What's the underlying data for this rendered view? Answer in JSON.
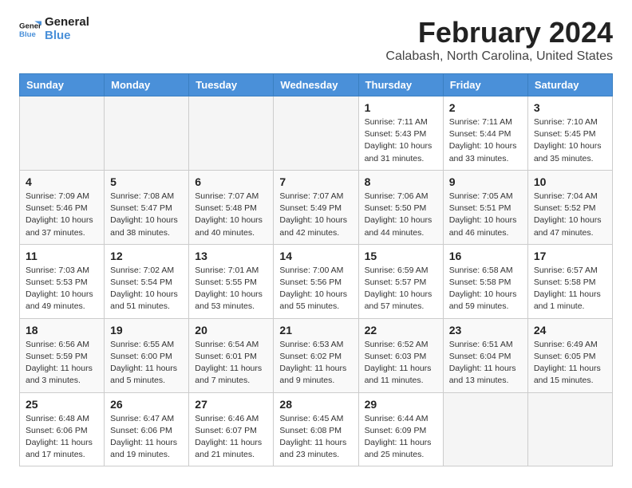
{
  "logo": {
    "line1": "General",
    "line2": "Blue"
  },
  "title": "February 2024",
  "location": "Calabash, North Carolina, United States",
  "weekdays": [
    "Sunday",
    "Monday",
    "Tuesday",
    "Wednesday",
    "Thursday",
    "Friday",
    "Saturday"
  ],
  "weeks": [
    [
      {
        "day": "",
        "info": "",
        "empty": true
      },
      {
        "day": "",
        "info": "",
        "empty": true
      },
      {
        "day": "",
        "info": "",
        "empty": true
      },
      {
        "day": "",
        "info": "",
        "empty": true
      },
      {
        "day": "1",
        "info": "Sunrise: 7:11 AM\nSunset: 5:43 PM\nDaylight: 10 hours\nand 31 minutes."
      },
      {
        "day": "2",
        "info": "Sunrise: 7:11 AM\nSunset: 5:44 PM\nDaylight: 10 hours\nand 33 minutes."
      },
      {
        "day": "3",
        "info": "Sunrise: 7:10 AM\nSunset: 5:45 PM\nDaylight: 10 hours\nand 35 minutes."
      }
    ],
    [
      {
        "day": "4",
        "info": "Sunrise: 7:09 AM\nSunset: 5:46 PM\nDaylight: 10 hours\nand 37 minutes."
      },
      {
        "day": "5",
        "info": "Sunrise: 7:08 AM\nSunset: 5:47 PM\nDaylight: 10 hours\nand 38 minutes."
      },
      {
        "day": "6",
        "info": "Sunrise: 7:07 AM\nSunset: 5:48 PM\nDaylight: 10 hours\nand 40 minutes."
      },
      {
        "day": "7",
        "info": "Sunrise: 7:07 AM\nSunset: 5:49 PM\nDaylight: 10 hours\nand 42 minutes."
      },
      {
        "day": "8",
        "info": "Sunrise: 7:06 AM\nSunset: 5:50 PM\nDaylight: 10 hours\nand 44 minutes."
      },
      {
        "day": "9",
        "info": "Sunrise: 7:05 AM\nSunset: 5:51 PM\nDaylight: 10 hours\nand 46 minutes."
      },
      {
        "day": "10",
        "info": "Sunrise: 7:04 AM\nSunset: 5:52 PM\nDaylight: 10 hours\nand 47 minutes."
      }
    ],
    [
      {
        "day": "11",
        "info": "Sunrise: 7:03 AM\nSunset: 5:53 PM\nDaylight: 10 hours\nand 49 minutes."
      },
      {
        "day": "12",
        "info": "Sunrise: 7:02 AM\nSunset: 5:54 PM\nDaylight: 10 hours\nand 51 minutes."
      },
      {
        "day": "13",
        "info": "Sunrise: 7:01 AM\nSunset: 5:55 PM\nDaylight: 10 hours\nand 53 minutes."
      },
      {
        "day": "14",
        "info": "Sunrise: 7:00 AM\nSunset: 5:56 PM\nDaylight: 10 hours\nand 55 minutes."
      },
      {
        "day": "15",
        "info": "Sunrise: 6:59 AM\nSunset: 5:57 PM\nDaylight: 10 hours\nand 57 minutes."
      },
      {
        "day": "16",
        "info": "Sunrise: 6:58 AM\nSunset: 5:58 PM\nDaylight: 10 hours\nand 59 minutes."
      },
      {
        "day": "17",
        "info": "Sunrise: 6:57 AM\nSunset: 5:58 PM\nDaylight: 11 hours\nand 1 minute."
      }
    ],
    [
      {
        "day": "18",
        "info": "Sunrise: 6:56 AM\nSunset: 5:59 PM\nDaylight: 11 hours\nand 3 minutes."
      },
      {
        "day": "19",
        "info": "Sunrise: 6:55 AM\nSunset: 6:00 PM\nDaylight: 11 hours\nand 5 minutes."
      },
      {
        "day": "20",
        "info": "Sunrise: 6:54 AM\nSunset: 6:01 PM\nDaylight: 11 hours\nand 7 minutes."
      },
      {
        "day": "21",
        "info": "Sunrise: 6:53 AM\nSunset: 6:02 PM\nDaylight: 11 hours\nand 9 minutes."
      },
      {
        "day": "22",
        "info": "Sunrise: 6:52 AM\nSunset: 6:03 PM\nDaylight: 11 hours\nand 11 minutes."
      },
      {
        "day": "23",
        "info": "Sunrise: 6:51 AM\nSunset: 6:04 PM\nDaylight: 11 hours\nand 13 minutes."
      },
      {
        "day": "24",
        "info": "Sunrise: 6:49 AM\nSunset: 6:05 PM\nDaylight: 11 hours\nand 15 minutes."
      }
    ],
    [
      {
        "day": "25",
        "info": "Sunrise: 6:48 AM\nSunset: 6:06 PM\nDaylight: 11 hours\nand 17 minutes."
      },
      {
        "day": "26",
        "info": "Sunrise: 6:47 AM\nSunset: 6:06 PM\nDaylight: 11 hours\nand 19 minutes."
      },
      {
        "day": "27",
        "info": "Sunrise: 6:46 AM\nSunset: 6:07 PM\nDaylight: 11 hours\nand 21 minutes."
      },
      {
        "day": "28",
        "info": "Sunrise: 6:45 AM\nSunset: 6:08 PM\nDaylight: 11 hours\nand 23 minutes."
      },
      {
        "day": "29",
        "info": "Sunrise: 6:44 AM\nSunset: 6:09 PM\nDaylight: 11 hours\nand 25 minutes."
      },
      {
        "day": "",
        "info": "",
        "empty": true
      },
      {
        "day": "",
        "info": "",
        "empty": true
      }
    ]
  ]
}
